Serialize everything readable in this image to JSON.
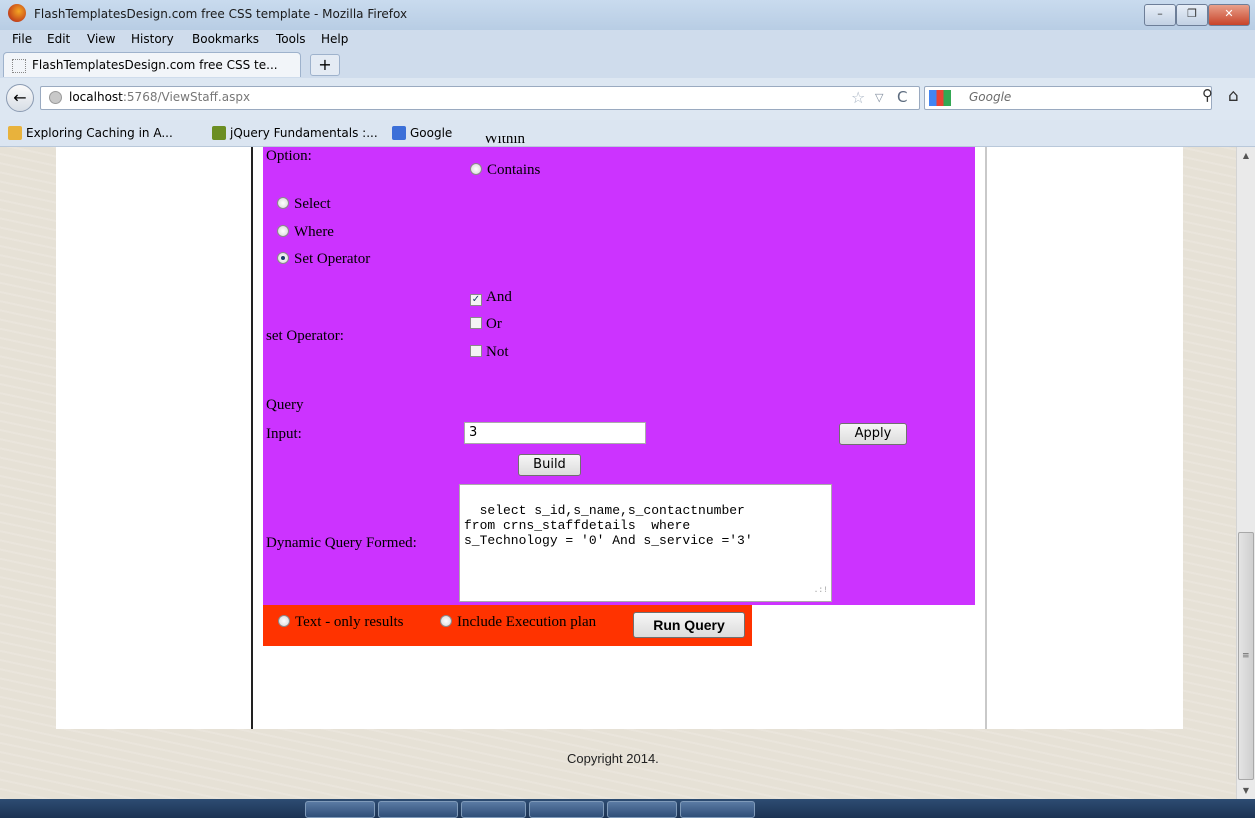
{
  "window": {
    "title": "FlashTemplatesDesign.com free CSS template - Mozilla Firefox",
    "minimize": "–",
    "maximize": "❐",
    "close": "✕"
  },
  "menu": {
    "file": "File",
    "edit": "Edit",
    "view": "View",
    "history": "History",
    "bookmarks": "Bookmarks",
    "tools": "Tools",
    "help": "Help"
  },
  "tab": {
    "label": "FlashTemplatesDesign.com free CSS te...",
    "new_tab": "+"
  },
  "nav": {
    "back": "←",
    "url_host": "localhost",
    "url_path": ":5768/ViewStaff.aspx",
    "search_placeholder": "Google",
    "star": "☆",
    "dropdown": "▽",
    "reload": "C",
    "search_go": "⚲",
    "home": "⌂"
  },
  "bookmarks": {
    "items": [
      {
        "label": "Exploring Caching in A..."
      },
      {
        "label": "jQuery Fundamentals :..."
      },
      {
        "label": "Google"
      }
    ]
  },
  "form": {
    "option_label": "Option:",
    "option_partial": "Within",
    "option_contains": "Contains",
    "mode_select": "Select",
    "mode_where": "Where",
    "mode_set_operator": "Set Operator",
    "mode_selected": "Set Operator",
    "set_operator_label": "set Operator:",
    "op_and": "And",
    "op_or": "Or",
    "op_not": "Not",
    "op_and_checked": true,
    "check_mark": "✓",
    "query_label": "Query",
    "input_label": "Input:",
    "input_value": "3",
    "apply_button": "Apply",
    "build_button": "Build",
    "dynamic_label": "Dynamic Query Formed:",
    "dynamic_query": "select s_id,s_name,s_contactnumber\nfrom crns_staffdetails  where\ns_Technology = '0' And s_service ='3'",
    "resize_grip": ".:!"
  },
  "run": {
    "text_only": "Text - only results",
    "include_plan": "Include Execution plan",
    "run_button": "Run Query"
  },
  "footer": {
    "copyright": "Copyright 2014."
  },
  "scrollbar": {
    "up": "▲",
    "down": "▼",
    "grip": "≡"
  },
  "colors": {
    "form_panel": "#cc33ff",
    "run_panel": "#ff3300"
  }
}
